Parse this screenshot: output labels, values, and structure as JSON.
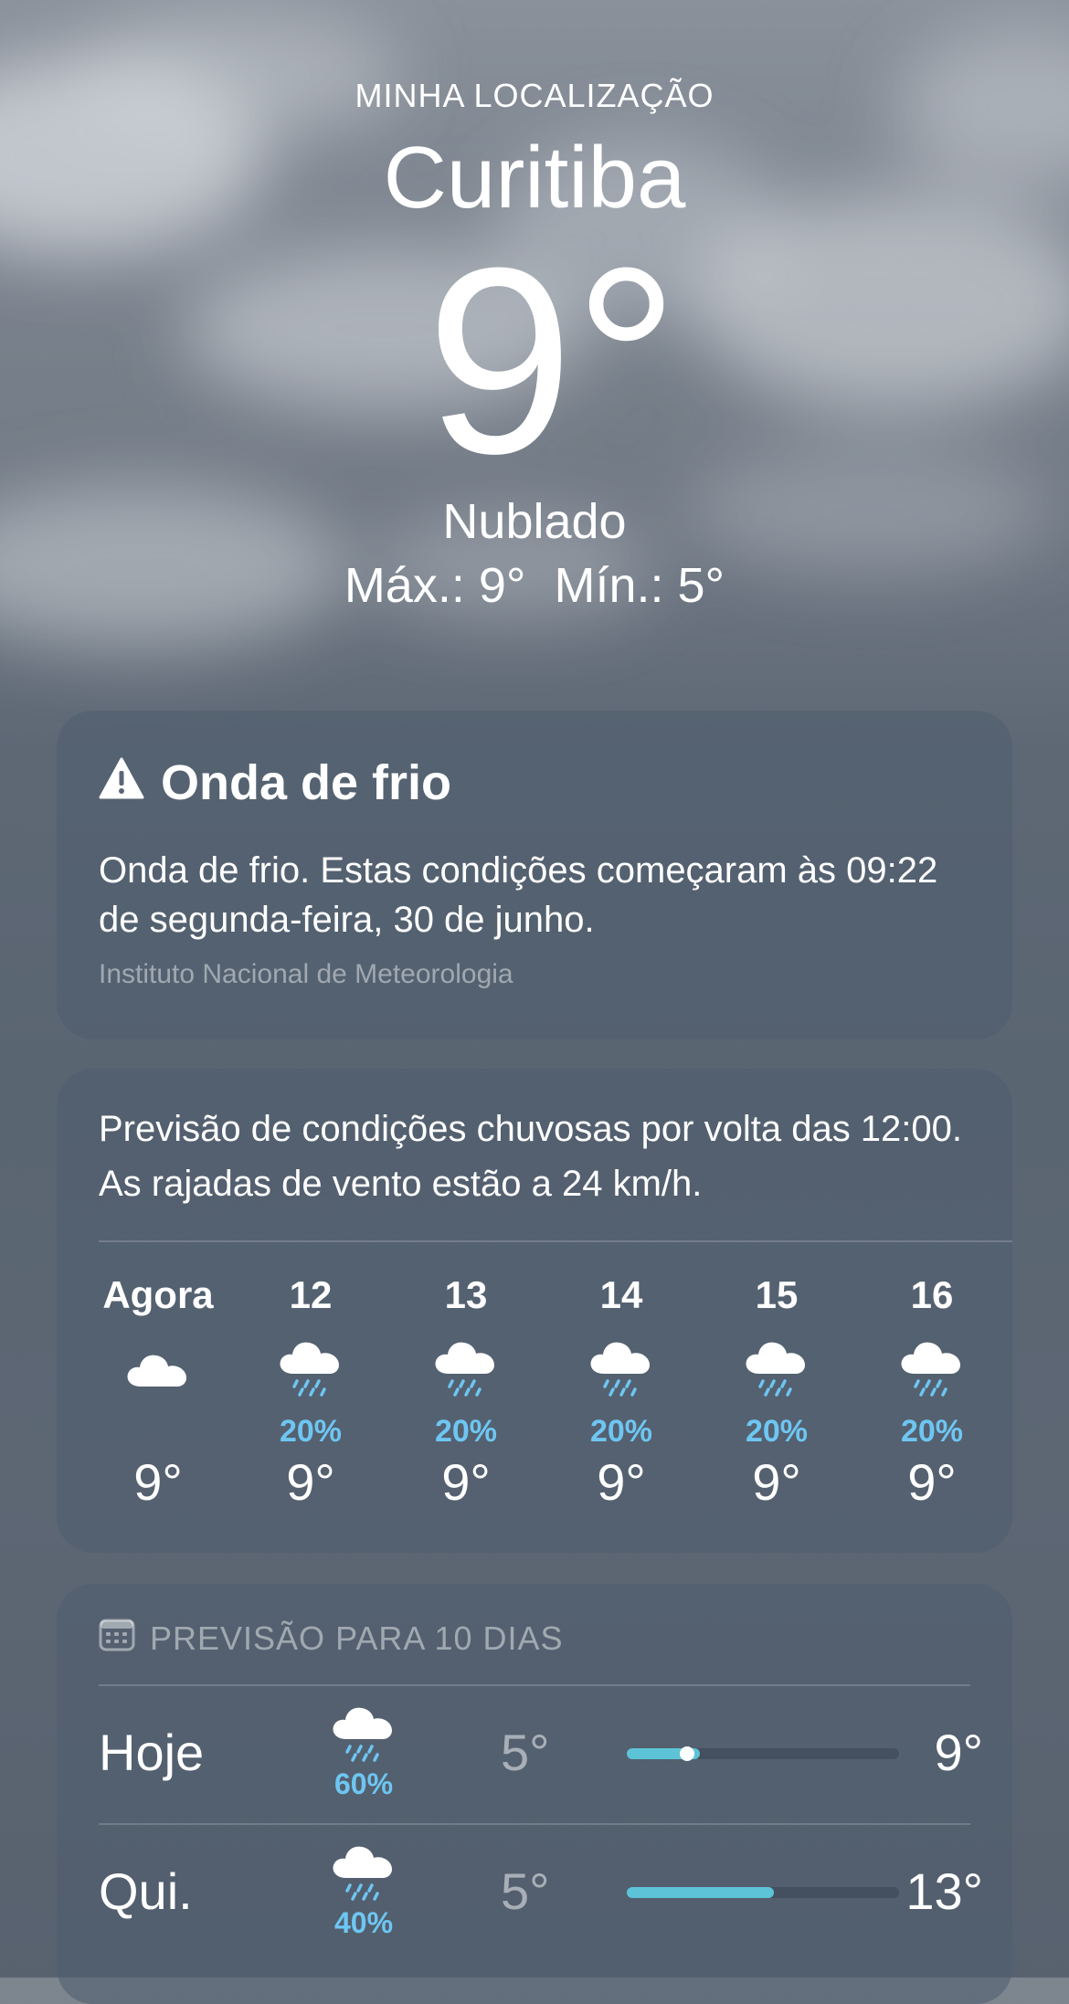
{
  "location": {
    "label": "MINHA LOCALIZAÇÃO",
    "city": "Curitiba",
    "temperature": "9°",
    "condition": "Nublado",
    "high": "Máx.: 9°",
    "low": "Mín.: 5°"
  },
  "alert": {
    "icon": "warning-triangle-icon",
    "title": "Onda de frio",
    "body": "Onda de frio. Estas condições começaram às 09:22 de segunda-feira, 30 de junho.",
    "source": "Instituto Nacional de Meteorologia"
  },
  "hourly": {
    "summary": "Previsão de condições chuvosas por volta das 12:00. As rajadas de vento estão a 24 km/h.",
    "hours": [
      {
        "label": "Agora",
        "icon": "cloud-icon",
        "pop": "",
        "temp": "9°"
      },
      {
        "label": "12",
        "icon": "cloud-rain-icon",
        "pop": "20%",
        "temp": "9°"
      },
      {
        "label": "13",
        "icon": "cloud-rain-icon",
        "pop": "20%",
        "temp": "9°"
      },
      {
        "label": "14",
        "icon": "cloud-rain-icon",
        "pop": "20%",
        "temp": "9°"
      },
      {
        "label": "15",
        "icon": "cloud-rain-icon",
        "pop": "20%",
        "temp": "9°"
      },
      {
        "label": "16",
        "icon": "cloud-rain-icon",
        "pop": "20%",
        "temp": "9°"
      }
    ]
  },
  "daily": {
    "header": "PREVISÃO PARA 10 DIAS",
    "header_icon": "calendar-icon",
    "days": [
      {
        "name": "Hoje",
        "icon": "cloud-rain-icon",
        "pop": "60%",
        "low": "5°",
        "high": "9°",
        "range_start": 0.0,
        "range_end": 0.27,
        "current": 0.22
      },
      {
        "name": "Qui.",
        "icon": "cloud-rain-icon",
        "pop": "40%",
        "low": "5°",
        "high": "13°",
        "range_start": 0.0,
        "range_end": 0.54
      }
    ]
  },
  "colors": {
    "accent_precip": "#6ec6f2",
    "range_bar": "#5cc4d6"
  }
}
